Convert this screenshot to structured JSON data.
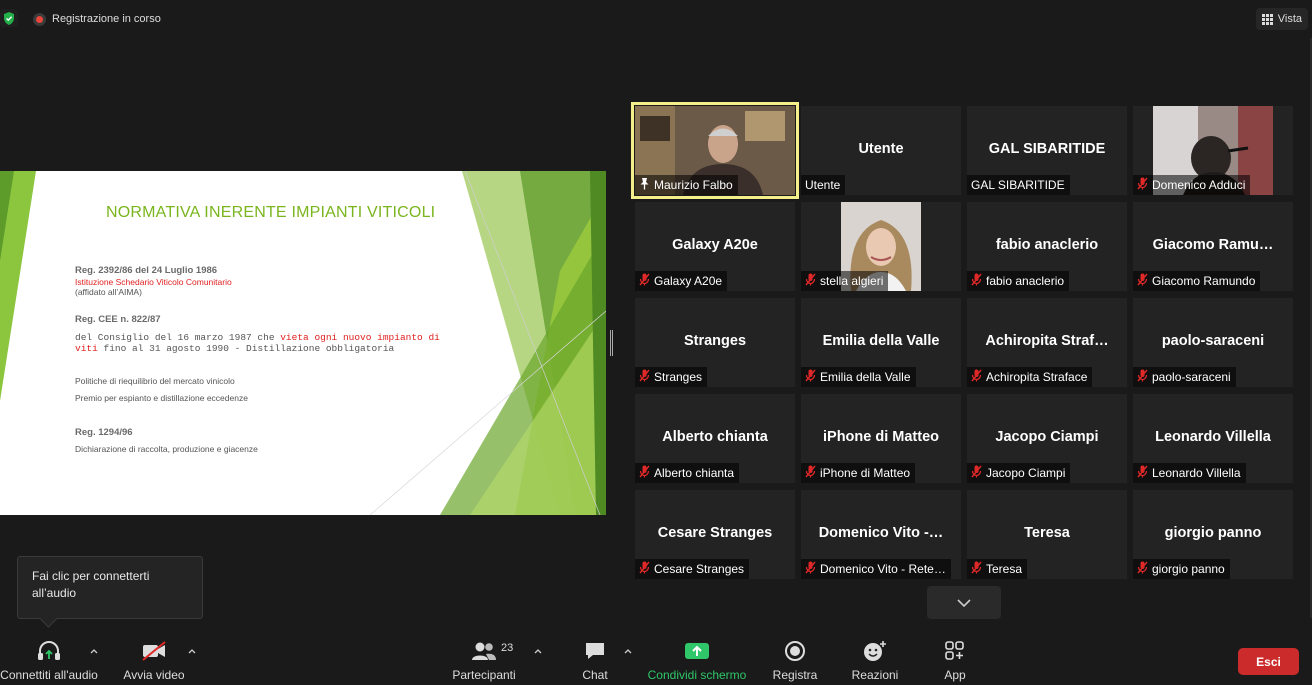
{
  "topbar": {
    "recording_label": "Registrazione in corso",
    "view_label": "Vista"
  },
  "slide": {
    "title": "NORMATIVA INERENTE IMPIANTI VITICOLI",
    "reg1": "Reg. 2392/86 del 24 Luglio 1986",
    "reg1_red": "Istituzione Schedario Viticolo Comunitario",
    "reg1_note": "(affidato all’AIMA)",
    "reg2": "Reg. CEE n. 822/87",
    "reg2_line1_a": "del Consiglio del 16 marzo 1987 che ",
    "reg2_line1_b": "vieta ogni nuovo impianto di",
    "reg2_line2_a": "viti",
    "reg2_line2_b": " fino al 31 agosto 1990 - Distillazione obbligatoria",
    "policy1": "Politiche di riequilibrio del mercato vinicolo",
    "policy2": "Premio per espianto e distillazione eccedenze",
    "reg3": "Reg. 1294/96",
    "reg3_desc": "Dichiarazione di raccolta, produzione e giacenze"
  },
  "participants": [
    {
      "center": "",
      "label": "Maurizio Falbo",
      "muted": false,
      "pinned": true,
      "video": true
    },
    {
      "center": "Utente",
      "label": "Utente",
      "muted": false,
      "pinned": false,
      "video": false
    },
    {
      "center": "GAL SIBARITIDE",
      "label": "GAL SIBARITIDE",
      "muted": false,
      "pinned": false,
      "video": false
    },
    {
      "center": "",
      "label": "Domenico Adduci",
      "muted": true,
      "pinned": false,
      "video": true
    },
    {
      "center": "Galaxy A20e",
      "label": "Galaxy A20e",
      "muted": true,
      "pinned": false,
      "video": false
    },
    {
      "center": "",
      "label": "stella algieri",
      "muted": true,
      "pinned": false,
      "video": true
    },
    {
      "center": "fabio anaclerio",
      "label": "fabio anaclerio",
      "muted": true,
      "pinned": false,
      "video": false
    },
    {
      "center": "Giacomo  Ramu…",
      "label": "Giacomo Ramundo",
      "muted": true,
      "pinned": false,
      "video": false
    },
    {
      "center": "Stranges",
      "label": "Stranges",
      "muted": true,
      "pinned": false,
      "video": false
    },
    {
      "center": "Emilia della Valle",
      "label": "Emilia della Valle",
      "muted": true,
      "pinned": false,
      "video": false
    },
    {
      "center": "Achiropita  Straf…",
      "label": "Achiropita Straface",
      "muted": true,
      "pinned": false,
      "video": false
    },
    {
      "center": "paolo-saraceni",
      "label": "paolo-saraceni",
      "muted": true,
      "pinned": false,
      "video": false
    },
    {
      "center": "Alberto chianta",
      "label": "Alberto chianta",
      "muted": true,
      "pinned": false,
      "video": false
    },
    {
      "center": "iPhone di Matteo",
      "label": "iPhone di Matteo",
      "muted": true,
      "pinned": false,
      "video": false
    },
    {
      "center": "Jacopo Ciampi",
      "label": "Jacopo Ciampi",
      "muted": true,
      "pinned": false,
      "video": false
    },
    {
      "center": "Leonardo Villella",
      "label": "Leonardo Villella",
      "muted": true,
      "pinned": false,
      "video": false
    },
    {
      "center": "Cesare Stranges",
      "label": "Cesare Stranges",
      "muted": true,
      "pinned": false,
      "video": false
    },
    {
      "center": "Domenico  Vito  -…",
      "label": "Domenico Vito - Rete…",
      "muted": true,
      "pinned": false,
      "video": false
    },
    {
      "center": "Teresa",
      "label": "Teresa",
      "muted": true,
      "pinned": false,
      "video": false
    },
    {
      "center": "giorgio panno",
      "label": "giorgio panno",
      "muted": true,
      "pinned": false,
      "video": false
    }
  ],
  "tooltip": {
    "line1": "Fai clic per connetterti",
    "line2": "all’audio"
  },
  "toolbar": {
    "audio": "Connettiti all'audio",
    "video": "Avvia video",
    "participants": "Partecipanti",
    "participant_count": "23",
    "chat": "Chat",
    "share": "Condividi schermo",
    "record": "Registra",
    "reactions": "Reazioni",
    "apps": "App",
    "leave": "Esci"
  },
  "colors": {
    "share_green": "#2fc76a",
    "leave_red": "#cc2b2b",
    "active_speaker": "#f4ef8a",
    "slide_green": "#7ab51d",
    "muted_red": "#e02828"
  }
}
